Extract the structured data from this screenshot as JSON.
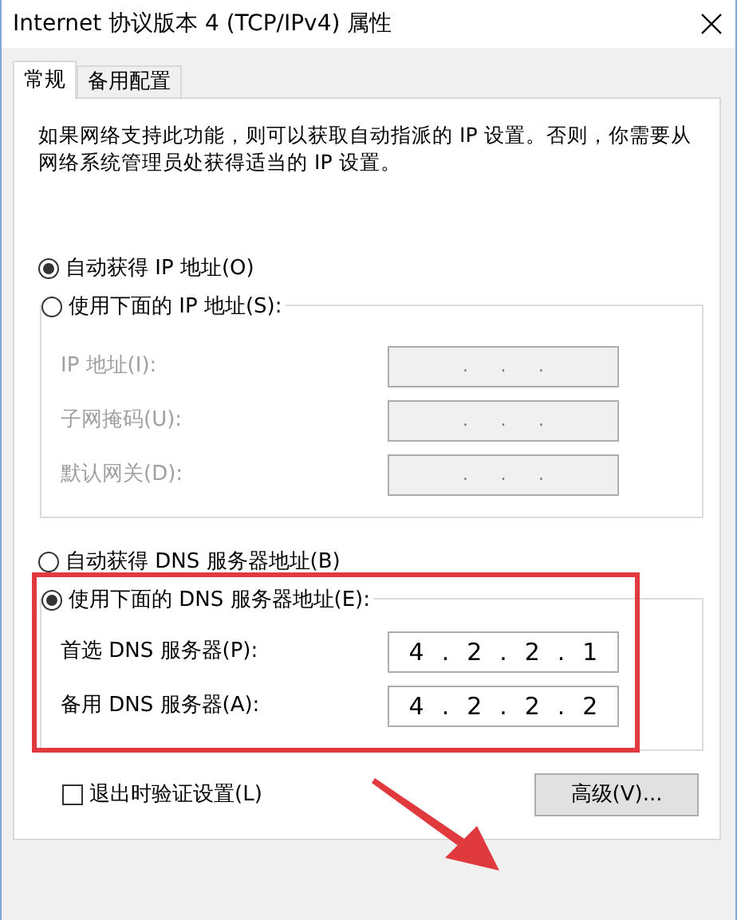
{
  "window": {
    "title": "Internet 协议版本 4 (TCP/IPv4) 属性"
  },
  "tabs": [
    {
      "label": "常规",
      "selected": true
    },
    {
      "label": "备用配置",
      "selected": false
    }
  ],
  "description": "如果网络支持此功能，则可以获取自动指派的 IP 设置。否则，你需要从网络系统管理员处获得适当的 IP 设置。",
  "ip_section": {
    "auto_option": {
      "label": "自动获得 IP 地址(O)",
      "selected": true
    },
    "manual_option": {
      "label": "使用下面的 IP 地址(S):",
      "selected": false
    },
    "fields": [
      {
        "label": "IP 地址(I):",
        "disabled": true,
        "separator": "."
      },
      {
        "label": "子网掩码(U):",
        "disabled": true,
        "separator": "."
      },
      {
        "label": "默认网关(D):",
        "disabled": true,
        "separator": "."
      }
    ]
  },
  "dns_section": {
    "auto_option": {
      "label": "自动获得 DNS 服务器地址(B)",
      "selected": false
    },
    "manual_option": {
      "label": "使用下面的 DNS 服务器地址(E):",
      "selected": true
    },
    "fields": [
      {
        "label": "首选 DNS 服务器(P):",
        "disabled": false,
        "separator": ".",
        "octets": [
          "4",
          "2",
          "2",
          "1"
        ]
      },
      {
        "label": "备用 DNS 服务器(A):",
        "disabled": false,
        "separator": ".",
        "octets": [
          "4",
          "2",
          "2",
          "2"
        ]
      }
    ]
  },
  "validate_on_exit": {
    "label": "退出时验证设置(L)",
    "checked": false
  },
  "advanced_button": "高级(V)...",
  "annotations": {
    "highlight_frame": true,
    "arrow": true
  }
}
